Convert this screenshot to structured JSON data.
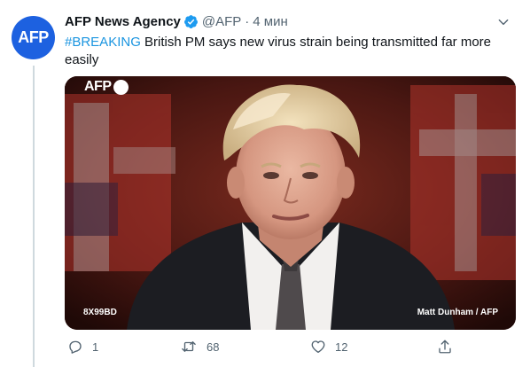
{
  "tweet": {
    "author_name": "AFP News Agency",
    "verified": true,
    "handle": "@AFP",
    "separator": "·",
    "time": "4 мин",
    "avatar_text": "AFP",
    "hashtag": "#BREAKING",
    "body": " British PM says new virus strain being transmitted far more easily"
  },
  "media": {
    "logo_text": "AFP",
    "photo_id": "8X99BD",
    "credit": "Matt Dunham / AFP"
  },
  "actions": {
    "reply_count": "1",
    "retweet_count": "68",
    "like_count": "12"
  },
  "colors": {
    "brand_blue": "#1d61e0",
    "link_blue": "#1b95e0",
    "secondary_text": "#536471",
    "verified_blue": "#1d9bf0"
  },
  "icons": {
    "verified": "verified-badge-icon",
    "caret": "chevron-down-icon",
    "reply": "reply-icon",
    "retweet": "retweet-icon",
    "like": "heart-icon",
    "share": "share-icon"
  }
}
